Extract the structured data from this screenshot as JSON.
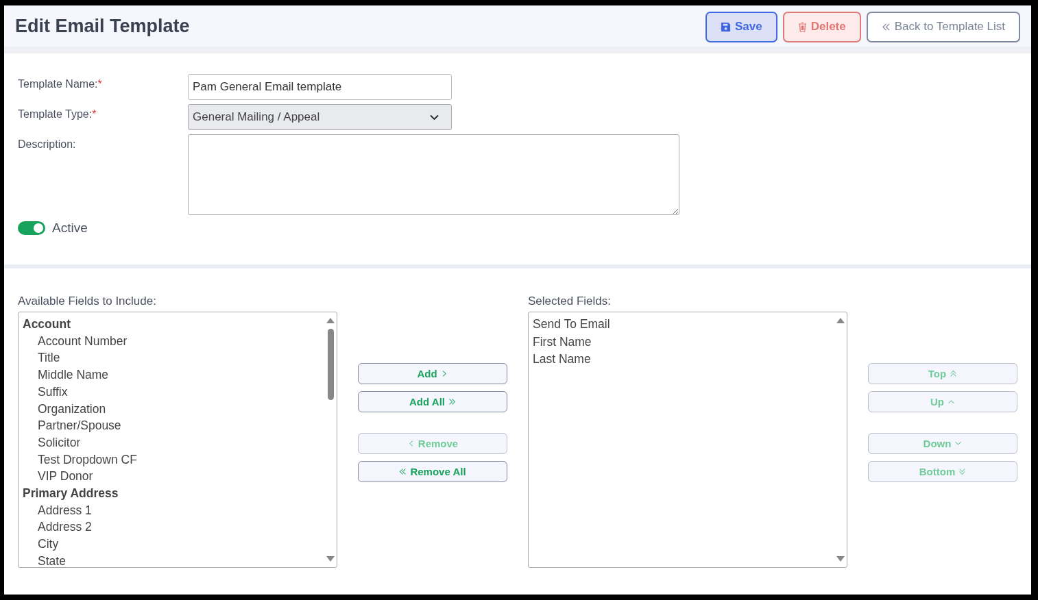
{
  "header": {
    "title": "Edit Email Template",
    "buttons": [
      {
        "kind": "save",
        "label": "Save"
      },
      {
        "kind": "delete",
        "label": "Delete"
      },
      {
        "kind": "back",
        "label": "Back to Template List"
      }
    ]
  },
  "form": {
    "name": {
      "label": "Template Name:",
      "required_mark": "*",
      "value": "Pam General Email template"
    },
    "type": {
      "label": "Template Type:",
      "required_mark": "*",
      "value": "General Mailing / Appeal"
    },
    "description": {
      "label": "Description:"
    },
    "active": {
      "label": "Active",
      "on": true
    }
  },
  "available": {
    "label": "Available Fields to Include:",
    "groups": [
      {
        "label": "Account",
        "children": [
          {
            "label": "Account Number"
          },
          {
            "label": "Title"
          },
          {
            "label": "Middle Name"
          },
          {
            "label": "Suffix"
          },
          {
            "label": "Organization"
          },
          {
            "label": "Partner/Spouse"
          },
          {
            "label": "Solicitor"
          },
          {
            "label": "Test Dropdown CF"
          },
          {
            "label": "VIP Donor"
          }
        ]
      },
      {
        "label": "Primary Address",
        "children": [
          {
            "label": "Address 1"
          },
          {
            "label": "Address 2"
          },
          {
            "label": "City"
          },
          {
            "label": "State"
          }
        ]
      }
    ]
  },
  "transfer_buttons": [
    {
      "kind": "add",
      "label": "Add",
      "disabled": false
    },
    {
      "kind": "add_all",
      "label": "Add All",
      "disabled": false
    },
    {
      "kind": "remove",
      "label": "Remove",
      "disabled": true
    },
    {
      "kind": "remove_all",
      "label": "Remove All",
      "disabled": false
    }
  ],
  "selected": {
    "label": "Selected Fields:",
    "items": [
      "Send To Email",
      "First Name",
      "Last Name"
    ]
  },
  "order_buttons": [
    {
      "kind": "top",
      "label": "Top",
      "disabled": true
    },
    {
      "kind": "up",
      "label": "Up",
      "disabled": true
    },
    {
      "kind": "down",
      "label": "Down",
      "disabled": true
    },
    {
      "kind": "bottom",
      "label": "Bottom",
      "disabled": true
    }
  ]
}
